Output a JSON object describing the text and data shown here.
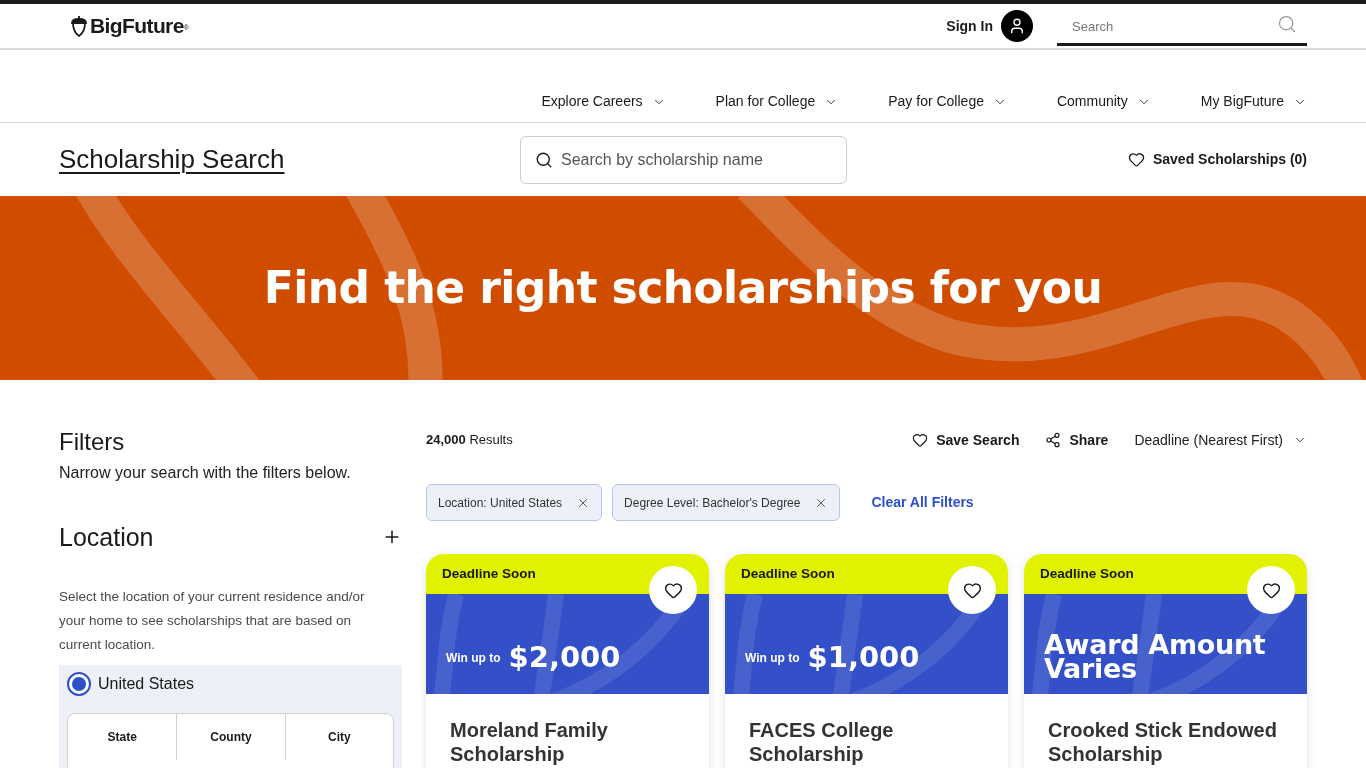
{
  "header": {
    "logo": "BigFuture$^{®}$",
    "sign_in": "Sign In",
    "search": {
      "placeholder": "Search"
    }
  },
  "nav": [
    "Explore Careers",
    "Plan for College",
    "Pay for College",
    "Community",
    "My BigFuture"
  ],
  "page_bar": {
    "title": "Scholarship Search",
    "search": {
      "placeholder": "Search by scholarship name"
    },
    "saved": "Saved Scholarships (0)"
  },
  "hero": {
    "heading": "Find the right scholarships for you"
  },
  "filters": {
    "title": "Filters",
    "subtitle": "Narrow your search with the filters below.",
    "sections": [
      {
        "title": "Location",
        "expanded": false,
        "description": "Select the location of your current residence and/or your home to see scholarships that are based on current location.",
        "options": [
          {
            "label": "United States",
            "selected": true
          }
        ],
        "levels": [
          "State",
          "County",
          "City"
        ]
      }
    ]
  },
  "results": {
    "count": "**24,000** Results",
    "actions": [
      {
        "kind": "save",
        "label": "Save Search"
      },
      {
        "kind": "share",
        "label": "Share"
      }
    ],
    "sort": "Deadline (Nearest First)",
    "chips": [
      "Location: United States",
      "Degree Level: Bachelor's Degree"
    ],
    "clear": "Clear All Filters",
    "cards": [
      {
        "badge": "Deadline Soon",
        "kind": "amount",
        "award_label": "Win up to",
        "award": "$2,000",
        "title": "Moreland Family Scholarship"
      },
      {
        "badge": "Deadline Soon",
        "kind": "amount",
        "award_label": "Win up to",
        "award": "$1,000",
        "title": "FACES College Scholarship"
      },
      {
        "badge": "Deadline Soon",
        "kind": "varies",
        "award": "Award Amount Varies",
        "title": "Crooked Stick Endowed Scholarship"
      }
    ]
  }
}
